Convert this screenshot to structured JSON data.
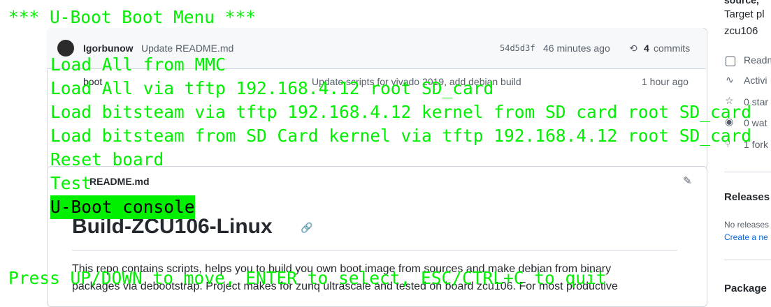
{
  "background": {
    "commit": {
      "author": "Igorbunow",
      "message": "Update README.md",
      "hash": "54d5d3f",
      "time": "46 minutes ago",
      "commits_count": "4",
      "commits_label": "commits"
    },
    "file_rows": [
      {
        "name": "boot",
        "message": "Update scripts for vivado 2019, add debian build",
        "time": "1 hour ago"
      }
    ],
    "readme": {
      "filename": "README.md",
      "heading": "Build-ZCU106-Linux",
      "text_line_1": "This repo contains scripts, helps you to build you own boot image from sources and make debian from binary",
      "text_line_2": "packages via debootstrap. Project makes for zunq ultrascale and tested on board zcu106. For most productive"
    },
    "sidebar": {
      "line1": "source,",
      "target": "Target pl",
      "board": "zcu106",
      "readme": "Readm",
      "activity": "Activi",
      "stars": "0 star",
      "watch": "0 wat",
      "forks": "1 fork",
      "releases_head": "Releases",
      "no_releases": "No releases",
      "create_new": "Create a ne",
      "packages_head": "Package"
    }
  },
  "terminal": {
    "title": "*** U-Boot Boot Menu ***",
    "items": [
      "Load All from MMC",
      "Load All via tftp 192.168.4.12 root SD_card",
      "Load bitsteam via tftp 192.168.4.12 kernel from SD card root SD_card",
      "Load bitsteam from SD Card kernel via tftp 192.168.4.12 root SD_card",
      "Reset board",
      "Test",
      "U-Boot console"
    ],
    "selected_index": 6,
    "footer": "Press UP/DOWN to move, ENTER to select, ESC/CTRL+C to quit",
    "colors": {
      "foreground": "#00f000",
      "selected_background": "#00f000",
      "selected_foreground": "#000000"
    }
  }
}
